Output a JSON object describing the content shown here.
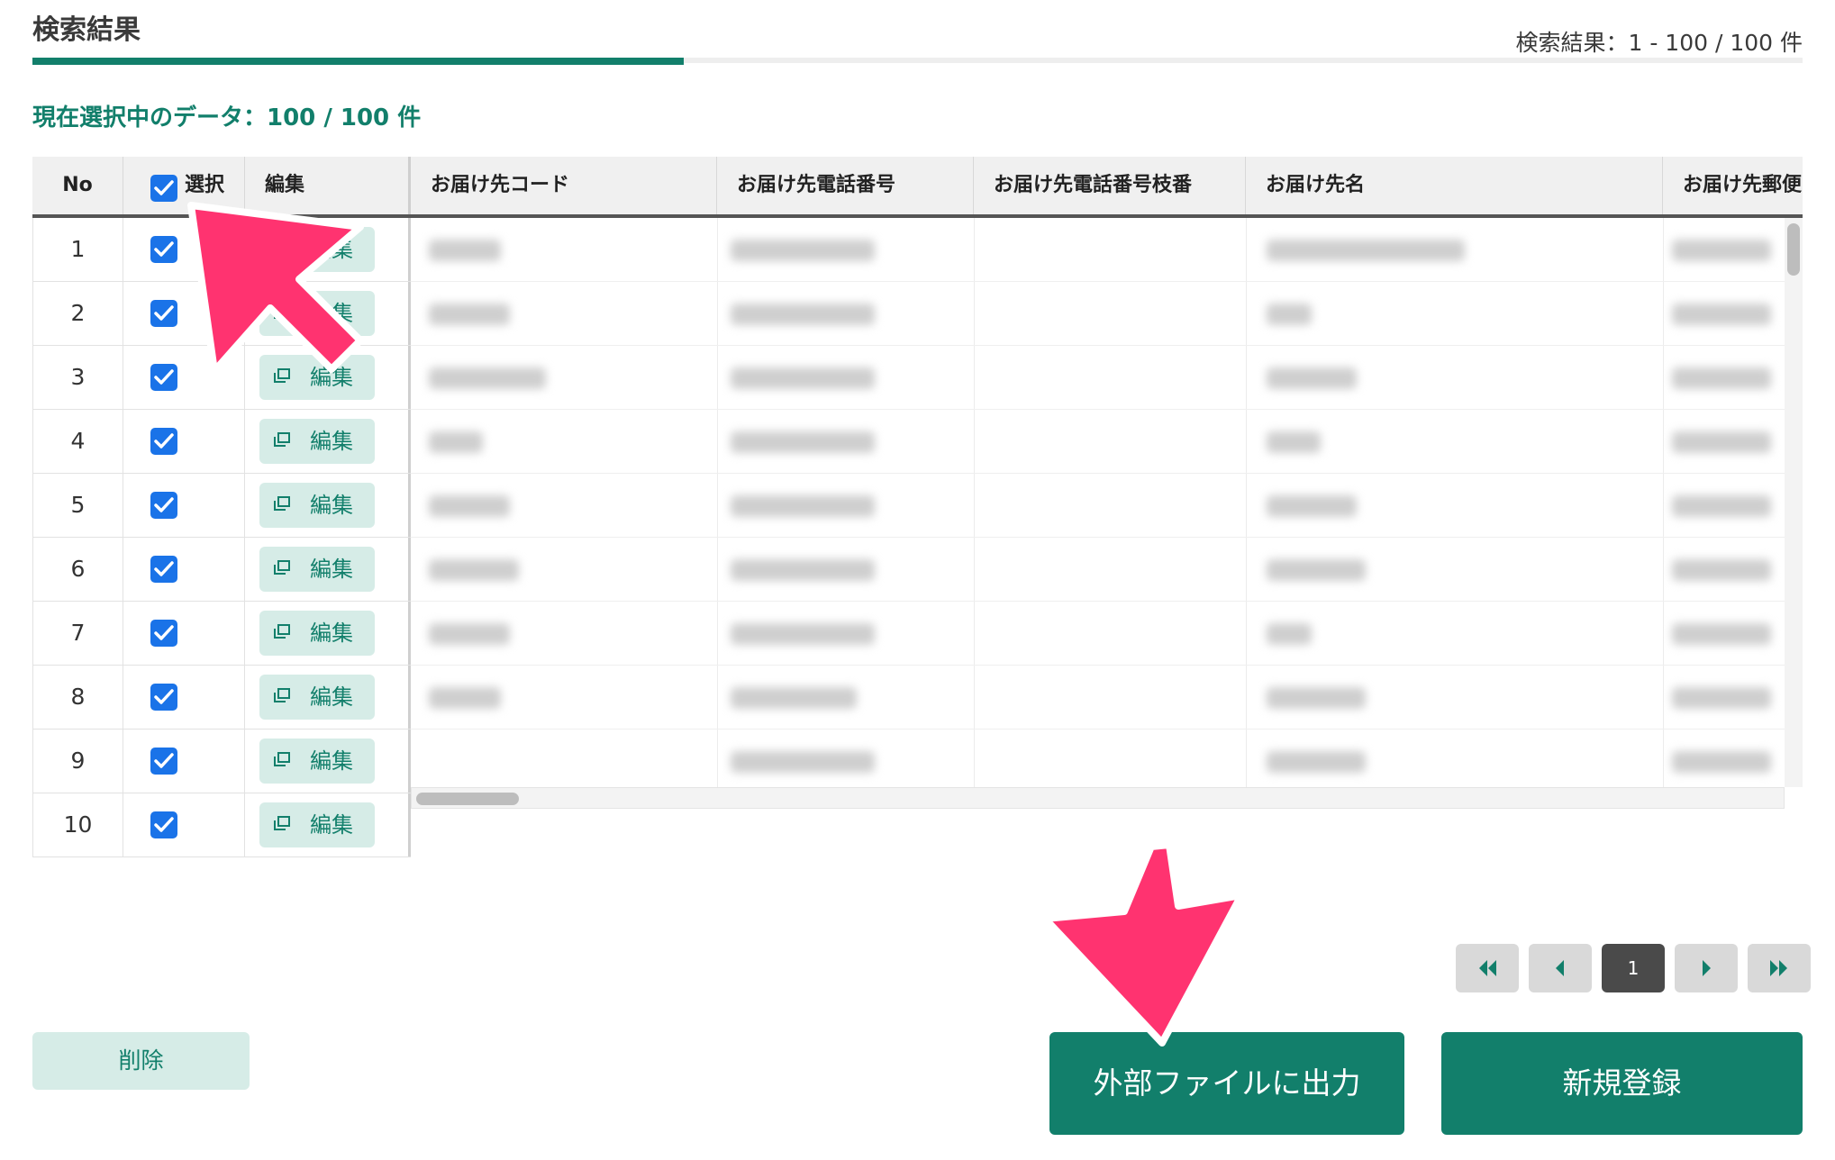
{
  "header": {
    "title": "検索結果",
    "result_count": "検索結果：1 - 100 / 100 件"
  },
  "selection": {
    "label": "現在選択中のデータ：100 / 100 件"
  },
  "table": {
    "columns": {
      "no": "No",
      "select": "選択",
      "edit": "編集",
      "delivery_code": "お届け先コード",
      "delivery_phone": "お届け先電話番号",
      "delivery_phone_branch": "お届け先電話番号枝番",
      "delivery_name": "お届け先名",
      "delivery_postal": "お届け先郵便"
    },
    "header_checkbox_checked": true,
    "edit_button_label": "編集",
    "rows": [
      {
        "no": "1",
        "checked": true
      },
      {
        "no": "2",
        "checked": true
      },
      {
        "no": "3",
        "checked": true
      },
      {
        "no": "4",
        "checked": true
      },
      {
        "no": "5",
        "checked": true
      },
      {
        "no": "6",
        "checked": true
      },
      {
        "no": "7",
        "checked": true
      },
      {
        "no": "8",
        "checked": true
      },
      {
        "no": "9",
        "checked": true
      },
      {
        "no": "10",
        "checked": true
      }
    ]
  },
  "pagination": {
    "current_page": "1",
    "first_icon": "double-chevron-left-icon",
    "prev_icon": "chevron-left-icon",
    "next_icon": "chevron-right-icon",
    "last_icon": "double-chevron-right-icon"
  },
  "actions": {
    "delete_label": "削除",
    "export_label": "外部ファイルに出力",
    "new_label": "新規登録"
  },
  "colors": {
    "accent": "#127f6b",
    "light_accent": "#d6ece7",
    "checkbox": "#1a73e8",
    "annotation_arrow": "#ff3370"
  }
}
